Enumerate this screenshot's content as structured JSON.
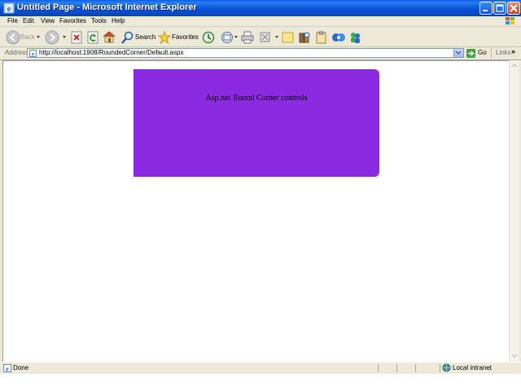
{
  "window": {
    "title": "Untitled Page - Microsoft Internet Explorer"
  },
  "menu": {
    "items": [
      "File",
      "Edit",
      "View",
      "Favorites",
      "Tools",
      "Help"
    ]
  },
  "toolbar": {
    "back_label": "Back",
    "search_label": "Search",
    "favorites_label": "Favorites"
  },
  "address": {
    "label": "Address",
    "url": "http://localhost:1908/RoundedCorner/Default.aspx",
    "go_label": "Go",
    "links_label": "Links"
  },
  "page": {
    "panel_text": "Asp.net Round Corner controls",
    "panel_color": "#8a2be2"
  },
  "status": {
    "text": "Done",
    "zone": "Local intranet"
  },
  "icons": [
    "ie-icon",
    "minimize-icon",
    "maximize-icon",
    "close-icon",
    "windows-logo-icon",
    "back-icon",
    "forward-icon",
    "stop-icon",
    "refresh-icon",
    "home-icon",
    "search-icon",
    "favorites-star-icon",
    "history-icon",
    "mail-icon",
    "print-icon",
    "edit-icon",
    "discuss-icon",
    "research-icon",
    "messenger-icon",
    "page-icon",
    "go-arrow-icon",
    "done-page-icon",
    "intranet-icon"
  ]
}
